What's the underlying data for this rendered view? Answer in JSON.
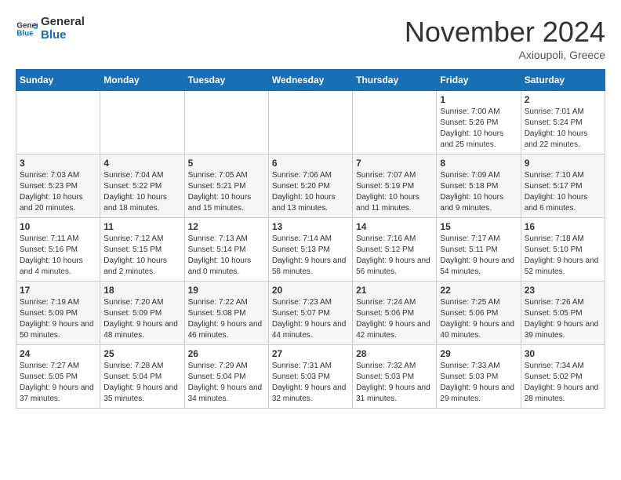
{
  "header": {
    "logo_line1": "General",
    "logo_line2": "Blue",
    "month": "November 2024",
    "location": "Axioupoli, Greece"
  },
  "days_of_week": [
    "Sunday",
    "Monday",
    "Tuesday",
    "Wednesday",
    "Thursday",
    "Friday",
    "Saturday"
  ],
  "weeks": [
    [
      {
        "day": "",
        "info": ""
      },
      {
        "day": "",
        "info": ""
      },
      {
        "day": "",
        "info": ""
      },
      {
        "day": "",
        "info": ""
      },
      {
        "day": "",
        "info": ""
      },
      {
        "day": "1",
        "info": "Sunrise: 7:00 AM\nSunset: 5:26 PM\nDaylight: 10 hours and 25 minutes."
      },
      {
        "day": "2",
        "info": "Sunrise: 7:01 AM\nSunset: 5:24 PM\nDaylight: 10 hours and 22 minutes."
      }
    ],
    [
      {
        "day": "3",
        "info": "Sunrise: 7:03 AM\nSunset: 5:23 PM\nDaylight: 10 hours and 20 minutes."
      },
      {
        "day": "4",
        "info": "Sunrise: 7:04 AM\nSunset: 5:22 PM\nDaylight: 10 hours and 18 minutes."
      },
      {
        "day": "5",
        "info": "Sunrise: 7:05 AM\nSunset: 5:21 PM\nDaylight: 10 hours and 15 minutes."
      },
      {
        "day": "6",
        "info": "Sunrise: 7:06 AM\nSunset: 5:20 PM\nDaylight: 10 hours and 13 minutes."
      },
      {
        "day": "7",
        "info": "Sunrise: 7:07 AM\nSunset: 5:19 PM\nDaylight: 10 hours and 11 minutes."
      },
      {
        "day": "8",
        "info": "Sunrise: 7:09 AM\nSunset: 5:18 PM\nDaylight: 10 hours and 9 minutes."
      },
      {
        "day": "9",
        "info": "Sunrise: 7:10 AM\nSunset: 5:17 PM\nDaylight: 10 hours and 6 minutes."
      }
    ],
    [
      {
        "day": "10",
        "info": "Sunrise: 7:11 AM\nSunset: 5:16 PM\nDaylight: 10 hours and 4 minutes."
      },
      {
        "day": "11",
        "info": "Sunrise: 7:12 AM\nSunset: 5:15 PM\nDaylight: 10 hours and 2 minutes."
      },
      {
        "day": "12",
        "info": "Sunrise: 7:13 AM\nSunset: 5:14 PM\nDaylight: 10 hours and 0 minutes."
      },
      {
        "day": "13",
        "info": "Sunrise: 7:14 AM\nSunset: 5:13 PM\nDaylight: 9 hours and 58 minutes."
      },
      {
        "day": "14",
        "info": "Sunrise: 7:16 AM\nSunset: 5:12 PM\nDaylight: 9 hours and 56 minutes."
      },
      {
        "day": "15",
        "info": "Sunrise: 7:17 AM\nSunset: 5:11 PM\nDaylight: 9 hours and 54 minutes."
      },
      {
        "day": "16",
        "info": "Sunrise: 7:18 AM\nSunset: 5:10 PM\nDaylight: 9 hours and 52 minutes."
      }
    ],
    [
      {
        "day": "17",
        "info": "Sunrise: 7:19 AM\nSunset: 5:09 PM\nDaylight: 9 hours and 50 minutes."
      },
      {
        "day": "18",
        "info": "Sunrise: 7:20 AM\nSunset: 5:09 PM\nDaylight: 9 hours and 48 minutes."
      },
      {
        "day": "19",
        "info": "Sunrise: 7:22 AM\nSunset: 5:08 PM\nDaylight: 9 hours and 46 minutes."
      },
      {
        "day": "20",
        "info": "Sunrise: 7:23 AM\nSunset: 5:07 PM\nDaylight: 9 hours and 44 minutes."
      },
      {
        "day": "21",
        "info": "Sunrise: 7:24 AM\nSunset: 5:06 PM\nDaylight: 9 hours and 42 minutes."
      },
      {
        "day": "22",
        "info": "Sunrise: 7:25 AM\nSunset: 5:06 PM\nDaylight: 9 hours and 40 minutes."
      },
      {
        "day": "23",
        "info": "Sunrise: 7:26 AM\nSunset: 5:05 PM\nDaylight: 9 hours and 39 minutes."
      }
    ],
    [
      {
        "day": "24",
        "info": "Sunrise: 7:27 AM\nSunset: 5:05 PM\nDaylight: 9 hours and 37 minutes."
      },
      {
        "day": "25",
        "info": "Sunrise: 7:28 AM\nSunset: 5:04 PM\nDaylight: 9 hours and 35 minutes."
      },
      {
        "day": "26",
        "info": "Sunrise: 7:29 AM\nSunset: 5:04 PM\nDaylight: 9 hours and 34 minutes."
      },
      {
        "day": "27",
        "info": "Sunrise: 7:31 AM\nSunset: 5:03 PM\nDaylight: 9 hours and 32 minutes."
      },
      {
        "day": "28",
        "info": "Sunrise: 7:32 AM\nSunset: 5:03 PM\nDaylight: 9 hours and 31 minutes."
      },
      {
        "day": "29",
        "info": "Sunrise: 7:33 AM\nSunset: 5:03 PM\nDaylight: 9 hours and 29 minutes."
      },
      {
        "day": "30",
        "info": "Sunrise: 7:34 AM\nSunset: 5:02 PM\nDaylight: 9 hours and 28 minutes."
      }
    ]
  ]
}
